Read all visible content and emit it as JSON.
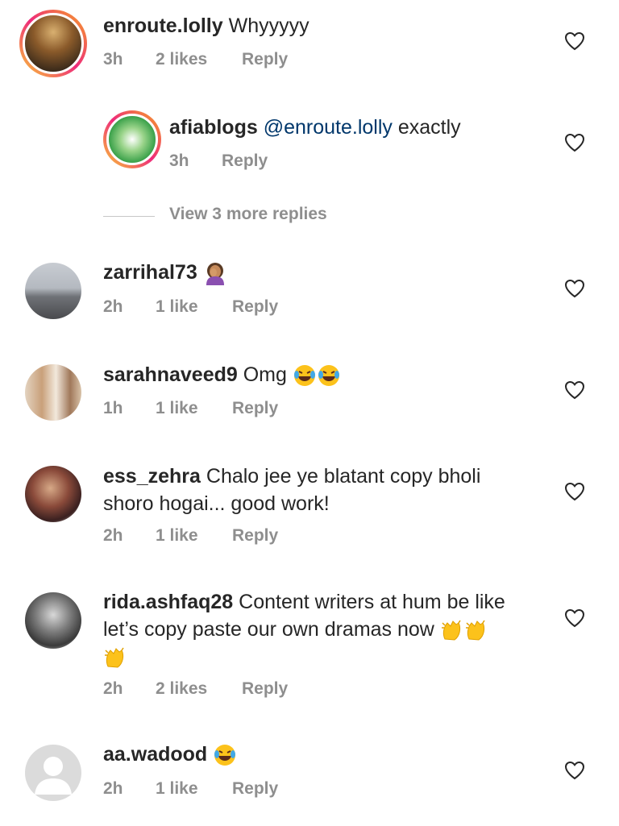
{
  "view_more_replies": "View 3 more replies",
  "colors": {
    "text": "#262626",
    "meta": "#8e8e8e",
    "mention": "#00376b",
    "divider": "#c7c7c7"
  },
  "comments": [
    {
      "username": "enroute.lolly",
      "text": "Whyyyyy",
      "time": "3h",
      "likes": "2 likes",
      "reply": "Reply"
    },
    {
      "username": "afiablogs",
      "mention": "@enroute.lolly",
      "text": " exactly",
      "time": "3h",
      "reply": "Reply"
    },
    {
      "username": "zarrihal73",
      "emoji": "woman-facepalming-emoji",
      "time": "2h",
      "likes": "1 like",
      "reply": "Reply"
    },
    {
      "username": "sarahnaveed9",
      "text": " Omg",
      "emoji": "laughing-tears-emoji",
      "time": "1h",
      "likes": "1 like",
      "reply": "Reply"
    },
    {
      "username": "ess_zehra",
      "text_line1": " Chalo jee ye blatant copy bholi",
      "text_line2": "shoro hogai... good work!",
      "time": "2h",
      "likes": "1 like",
      "reply": "Reply"
    },
    {
      "username": "rida.ashfaq28",
      "text_line1": " Content writers at hum be like",
      "text_line2": "let’s copy paste our own dramas now",
      "emoji": "clapping-hands-emoji",
      "time": "2h",
      "likes": "2 likes",
      "reply": "Reply"
    },
    {
      "username": "aa.wadood",
      "emoji": "laughing-tears-emoji",
      "time": "2h",
      "likes": "1 like",
      "reply": "Reply"
    }
  ]
}
